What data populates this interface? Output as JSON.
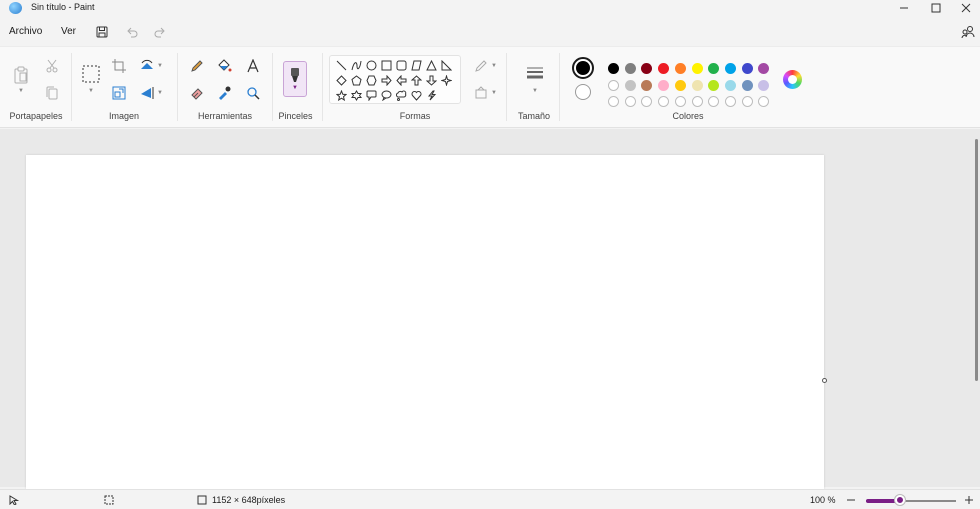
{
  "window": {
    "title": "Sin título - Paint",
    "controls": [
      "minimize-icon",
      "maximize-icon",
      "close-icon"
    ]
  },
  "menu": {
    "items": [
      {
        "label": "Archivo"
      },
      {
        "label": "Ver"
      }
    ],
    "quick_actions": [
      "save-icon",
      "undo-icon",
      "redo-icon"
    ],
    "account_icon": "people-icon"
  },
  "ribbon": {
    "groups": {
      "clipboard": {
        "label": "Portapapeles",
        "tools": [
          "paste-icon",
          "cut-icon",
          "copy-icon"
        ]
      },
      "image": {
        "label": "Imagen",
        "tools": [
          "selection-icon",
          "crop-icon",
          "resize-icon",
          "rotate-icon",
          "flip-icon"
        ]
      },
      "tools": {
        "label": "Herramientas",
        "tools": [
          "pencil-icon",
          "fill-bucket-icon",
          "text-icon",
          "eraser-icon",
          "color-picker-icon",
          "magnifier-icon"
        ]
      },
      "brushes": {
        "label": "Pinceles",
        "tools": [
          "brush-icon"
        ]
      },
      "shapes": {
        "label": "Formas",
        "items": [
          "line",
          "curve",
          "oval",
          "rectangle",
          "rounded-rectangle",
          "polygon",
          "triangle",
          "right-triangle",
          "diamond",
          "pentagon",
          "hexagon",
          "right-arrow",
          "left-arrow",
          "up-arrow",
          "down-arrow",
          "four-point-star",
          "five-point-star",
          "six-point-star",
          "rounded-callout",
          "oval-callout",
          "cloud-callout",
          "heart",
          "lightning"
        ],
        "outline_icon": "outline-icon",
        "fill_icon": "fill-icon"
      },
      "size": {
        "label": "Tamaño",
        "tools": [
          "line-size-icon"
        ]
      },
      "colors": {
        "label": "Colores",
        "primary": "#000000",
        "secondary": "#ffffff",
        "row1": [
          "#000000",
          "#7f7f7f",
          "#880015",
          "#ed1c24",
          "#ff7f27",
          "#fff200",
          "#22b14c",
          "#00a2e8",
          "#3f48cc",
          "#a349a4"
        ],
        "row2": [
          "#ffffff",
          "#c3c3c3",
          "#b97a57",
          "#ffaec9",
          "#ffc90e",
          "#efe4b0",
          "#b5e61d",
          "#99d9ea",
          "#7092be",
          "#c8bfe7"
        ],
        "row3_empty_count": 10,
        "edit_colors_icon": "color-wheel-icon"
      }
    }
  },
  "status": {
    "pointer_icon": "pointer-icon",
    "selection_icon": "selection-size-icon",
    "canvas_size": "1152 × 648píxeles",
    "zoom": "100 %",
    "zoom_level": 0.38
  }
}
